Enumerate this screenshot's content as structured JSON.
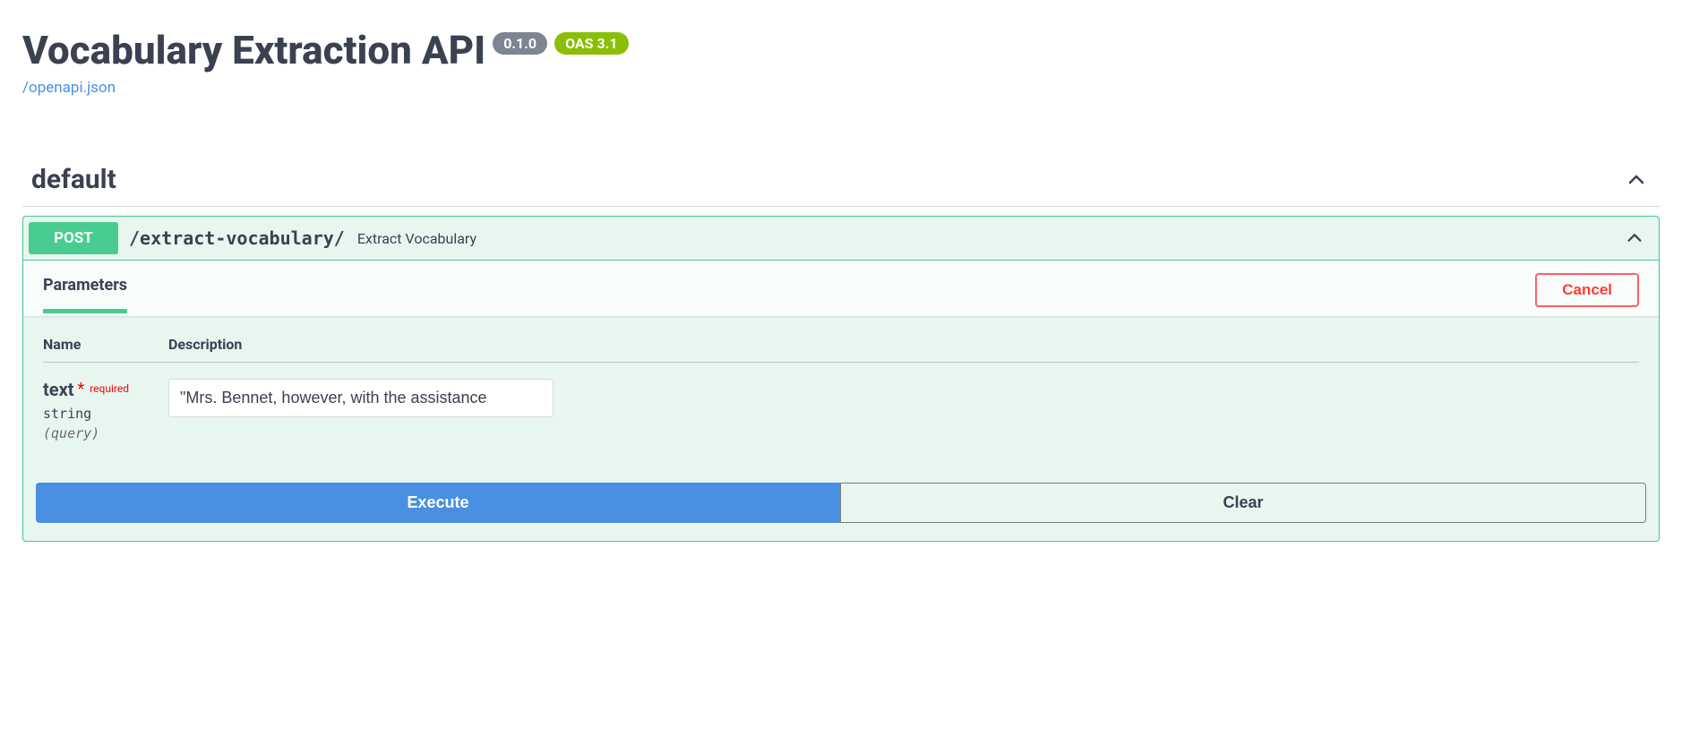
{
  "header": {
    "title": "Vocabulary Extraction API",
    "version": "0.1.0",
    "oas": "OAS 3.1",
    "spec_link": "/openapi.json"
  },
  "section": {
    "name": "default"
  },
  "operation": {
    "method": "POST",
    "path": "/extract-vocabulary/",
    "summary": "Extract Vocabulary",
    "tab_label": "Parameters",
    "cancel_label": "Cancel",
    "columns": {
      "name": "Name",
      "description": "Description"
    },
    "param": {
      "name": "text",
      "required_label": "required",
      "type": "string",
      "in": "(query)",
      "value": "\"Mrs. Bennet, however, with the assistance"
    },
    "execute_label": "Execute",
    "clear_label": "Clear"
  }
}
